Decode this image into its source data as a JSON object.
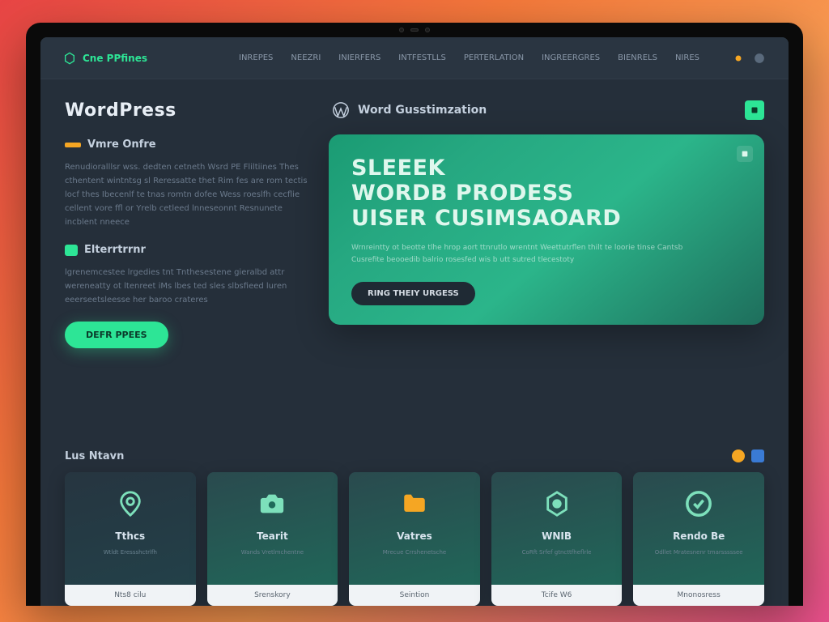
{
  "brand": {
    "name": "Cne PPfines"
  },
  "nav": {
    "items": [
      "INREPES",
      "NEEZRI",
      "INIERFERS",
      "INTFESTLLS",
      "PERTERLATION",
      "INGREERGRES",
      "BIENRELS",
      "NIRES"
    ]
  },
  "sidebar": {
    "title": "WordPress",
    "section1": {
      "label": "Vmre Onfre",
      "para": "Renudioralllsr wss. dedten cetneth Wsrd PE Fliltiines Thes cthentent wintntsg sl Reressatte thet Rim fes are rom tectis locf thes Ibecenlf te tnas romtn dofee Wess roeslfh cecflie cellent vore ffl or Yrelb cetleed lnneseonnt Resnunete incblent nneece"
    },
    "section2": {
      "label": "Elterrtrrnr",
      "para": "lgrenemcestee lrgedies tnt Tnthesestene gieralbd attr wereneatty ot ltenreet iMs lbes ted sles slbsfieed luren eeerseetsleesse her baroo crateres"
    },
    "cta": "DEFR PPEES"
  },
  "header": {
    "title": "Word Gusstimzation"
  },
  "hero": {
    "line1": "SLEEEK",
    "line2": "WORDB PRODESS",
    "line3": "UISER CUSIMSAOARD",
    "sub": "Wrnreintty ot beotte tlhe hrop aort ttnrutlo wrentnt Weettutrflen thilt te loorie tinse Cantsb Cusrefite beooedib balrio rosesfed wis b utt sutred tlecestoty",
    "btn": "RING THEIY URGESS"
  },
  "bottom": {
    "title": "Lus Ntavn"
  },
  "cards": [
    {
      "title": "Tthcs",
      "desc": "Wtldt Eressshctrlfh",
      "foot": "Nts8 cilu"
    },
    {
      "title": "Tearit",
      "desc": "Wands Vretlmchentne",
      "foot": "Srenskory"
    },
    {
      "title": "Vatres",
      "desc": "Mrecue Crrshenetsche",
      "foot": "Seintion"
    },
    {
      "title": "WNIB",
      "desc": "CoRft Srfef gtncttfheflrle",
      "foot": "Tcife W6"
    },
    {
      "title": "Rendo Be",
      "desc": "Odllet Mratesnenr tmarsssssee",
      "foot": "Mnonosress"
    }
  ]
}
